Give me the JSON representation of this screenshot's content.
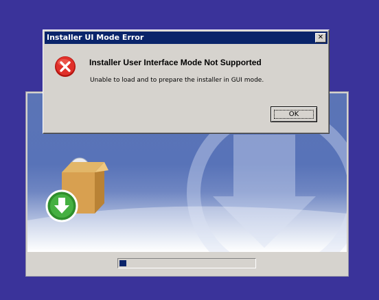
{
  "dialog": {
    "title": "Installer UI Mode Error",
    "close_glyph": "✕",
    "heading": "Installer User Interface Mode Not Supported",
    "message": "Unable to load and to prepare the installer in GUI mode.",
    "ok_label": "OK",
    "icon": "error-icon"
  },
  "splash": {
    "progress_fraction": 0.05,
    "icons": [
      "install-package-icon",
      "download-arrow-icon"
    ]
  },
  "colors": {
    "desktop": "#3a339a",
    "titlebar": "#0a246a",
    "face": "#d6d3ce",
    "error_red": "#e0302a",
    "download_green": "#3fa63b"
  }
}
